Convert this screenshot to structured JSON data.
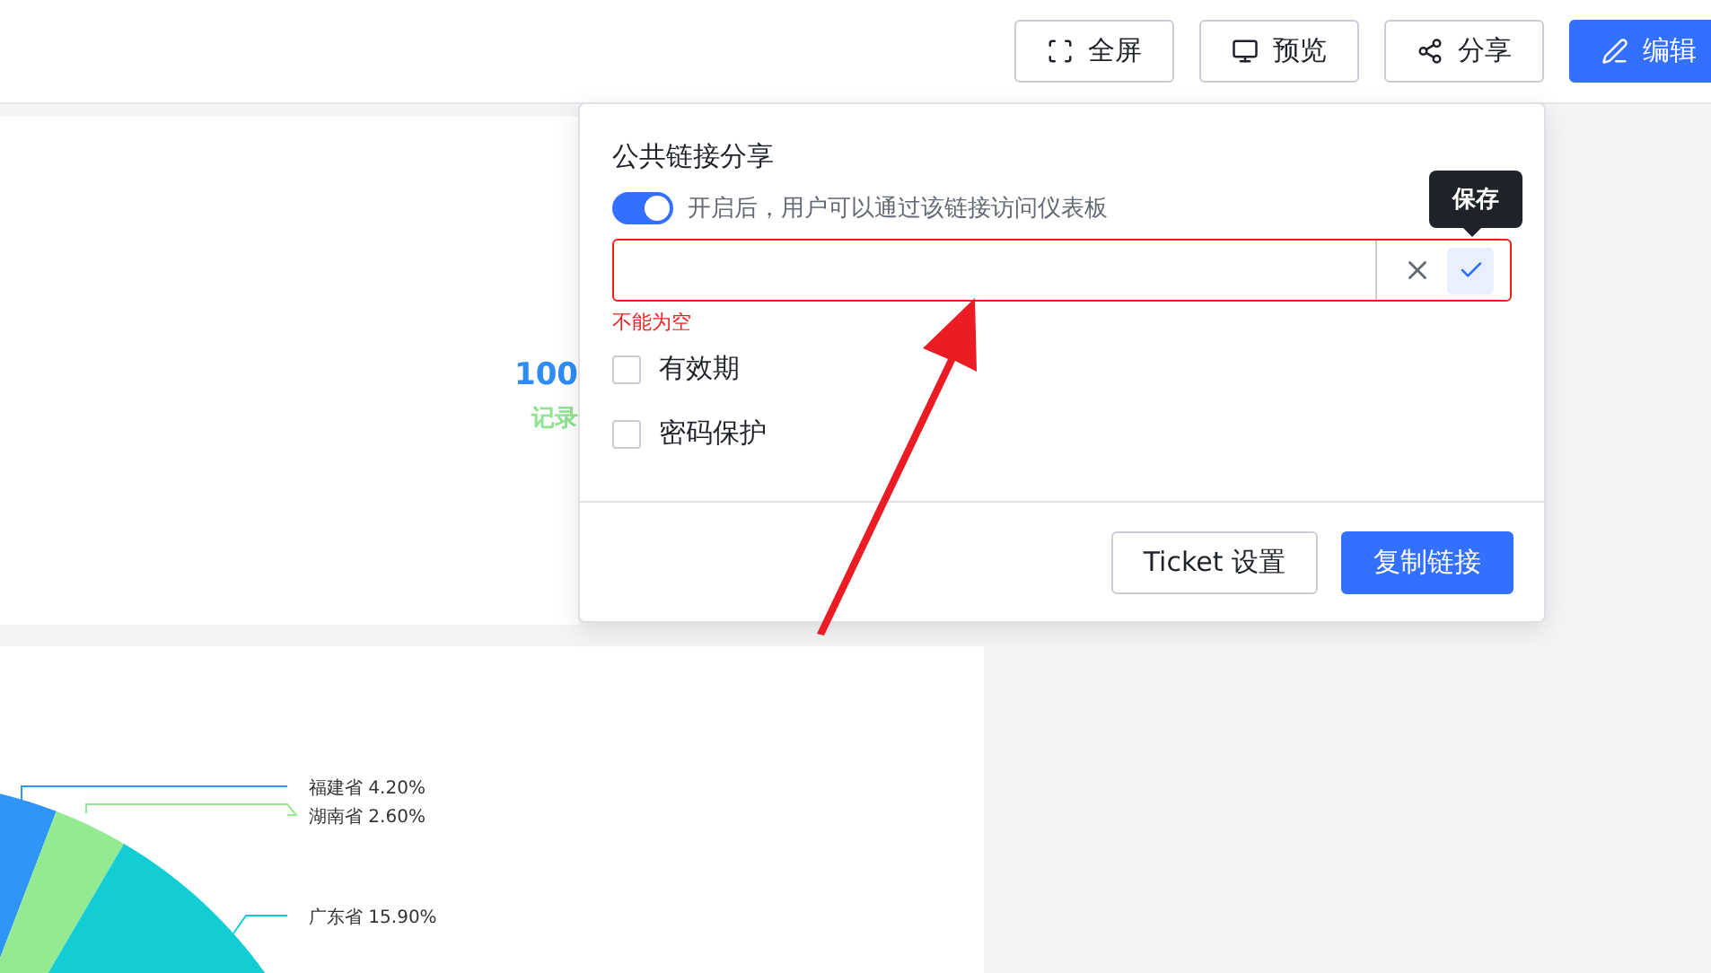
{
  "toolbar": {
    "buttons": [
      {
        "kind": "fullscreen",
        "label": "全屏",
        "primary": false
      },
      {
        "kind": "preview",
        "label": "预览",
        "primary": false
      },
      {
        "kind": "share",
        "label": "分享",
        "primary": false
      },
      {
        "kind": "edit",
        "label": "编辑",
        "primary": true
      }
    ]
  },
  "stat_card": {
    "value": "100",
    "label": "记录"
  },
  "pie_card": {
    "labels": [
      "福建省 4.20%",
      "湖南省 2.60%",
      "广东省 15.90%"
    ]
  },
  "share_popup": {
    "title": "公共链接分享",
    "toggle": {
      "on": true,
      "label": "开启后，用户可以通过该链接访问仪表板"
    },
    "link_input": {
      "error": "不能为空"
    },
    "tooltip": "保存",
    "options": [
      {
        "label": "有效期",
        "checked": false
      },
      {
        "label": "密码保护",
        "checked": false
      }
    ],
    "buttons": [
      {
        "label": "Ticket 设置",
        "primary": false
      },
      {
        "label": "复制链接",
        "primary": true
      }
    ]
  }
}
